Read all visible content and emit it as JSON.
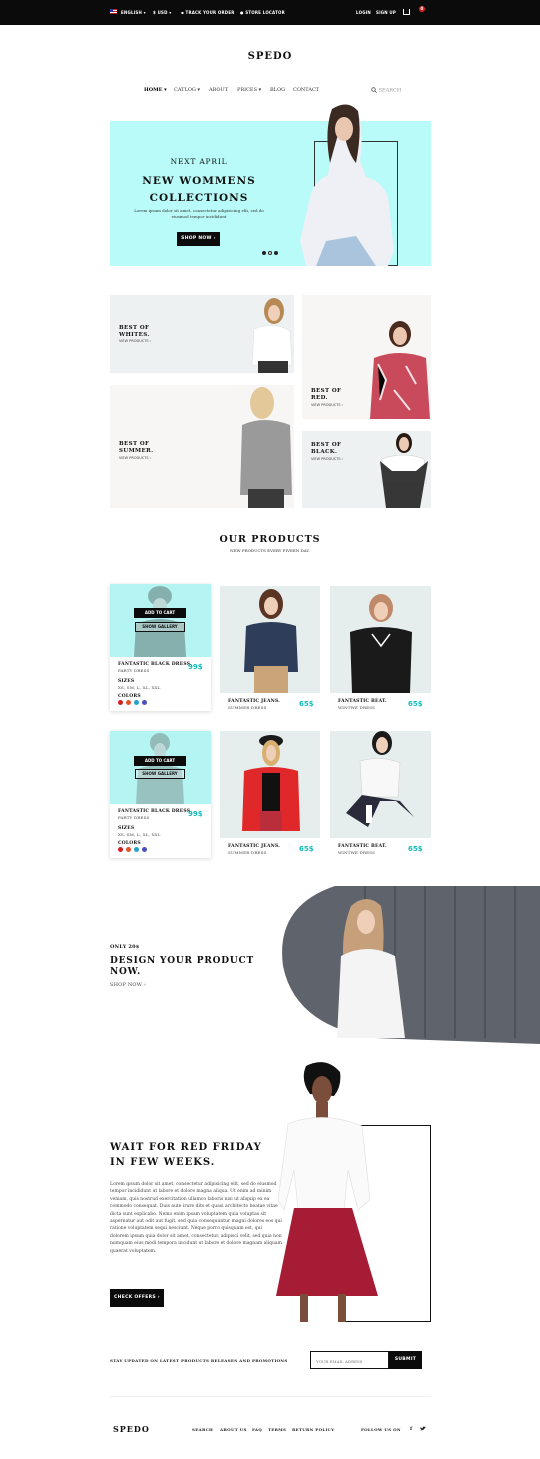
{
  "topbar": {
    "language": "ENGLISH",
    "currency": "USD",
    "track": "TRACK YOUR ORDER",
    "store": "STORE LOCATOR",
    "login": "LOGIN",
    "signup": "SIGN UP",
    "cart_count": "0"
  },
  "brand": "SPEDO",
  "nav": [
    {
      "label": "HOME"
    },
    {
      "label": "CATLOG"
    },
    {
      "label": "ABOUT"
    },
    {
      "label": "PRICES"
    },
    {
      "label": "BLOG"
    },
    {
      "label": "CONTACT"
    }
  ],
  "search_placeholder": "SEARCH",
  "hero": {
    "kicker": "NEXT APRIL",
    "title1": "NEW WOMMENS",
    "title2": "COLLECTIONS",
    "text": "Lorem ipsum dolor sit amet, consectetur adipisicing elit, sed do eiusmod tempor incididunt",
    "button": "SHOP NOW"
  },
  "tiles": [
    {
      "l1": "BEST OF",
      "l2": "WHITES.",
      "link": "VIEW PRODUCTS"
    },
    {
      "l1": "BEST OF",
      "l2": "RED.",
      "link": "VIEW PRODUCTS"
    },
    {
      "l1": "BEST OF",
      "l2": "SUMMER.",
      "link": "VIEW PRODUCTS"
    },
    {
      "l1": "BEST OF",
      "l2": "BLACK.",
      "link": "VIEW PRODUCTS"
    }
  ],
  "products_section": {
    "title": "OUR PRODUCTS",
    "subtitle": "NEW PRODUCTS EVERY FIVEEN DAY."
  },
  "card_actions": {
    "add": "ADD TO CART",
    "gallery": "SHOW GALLERY",
    "sizes_label": "SIZES",
    "sizes": "XS, SM, L, XL, XXL",
    "colors_label": "COLORS"
  },
  "products": [
    {
      "name": "FANTASTIC BLACK DRESS.",
      "sub": "PARTY DRESS",
      "price": "99$"
    },
    {
      "name": "FANTASTIC JEANS.",
      "sub": "SUMMER DRESS",
      "price": "65$"
    },
    {
      "name": "FANTASTIC BEAT.",
      "sub": "WINTWE DRESS",
      "price": "65$"
    },
    {
      "name": "FANTASTIC BLACK DRESS.",
      "sub": "PARTY DRESS",
      "price": "99$"
    },
    {
      "name": "FANTASTIC JEANS.",
      "sub": "SUMMER DRESS",
      "price": "65$"
    },
    {
      "name": "FANTASTIC BEAT.",
      "sub": "WINTWE DRESS",
      "price": "65$"
    }
  ],
  "swatch_colors": [
    "#d42020",
    "#e8502a",
    "#2a9fc4",
    "#4b4fc0"
  ],
  "design": {
    "kicker": "ONLY 20$",
    "title1": "DESIGN YOUR PRODUCT",
    "title2": "NOW.",
    "link": "SHOP NOW"
  },
  "friday": {
    "title1": "WAIT FOR RED FRIDAY",
    "title2": "IN FEW WEEKS.",
    "text": "Lorem ipsum dolor sit amet, consectetur adipisicing elit, sed do eiusmod tempor incididunt ut labore et dolore magna aliqua. Ut enim ad minim veniam, quis nostrud exercitation ullamco laboris nisi ut aliquip ex ea commodo consequat. Duis aute irure dits et quasi architecto beatae vitae dicta sunt explicabo. Nemo enim ipsam voluptatem quia voluptas sit aspernatur aut odit aut fugit, sed quia consequuntur magni dolores eos qui ratione voluptatem sequi nesciunt. Neque porro quisquam est, qui dolorem ipsum quia dolor sit amet, consectetur, adipisci velit, sed quia non numquam eius modi tempora incidunt ut labore et dolore magnam aliquam quaerat voluptatem.",
    "button": "CHECK OFFERS"
  },
  "newsletter": {
    "text": "STAY UPDATED ON LATEST PRODUCTS RELEASES AND PROMOTIONS",
    "placeholder": "YOUR EMAIL ADRESS",
    "button": "SUBMIT"
  },
  "footer": {
    "links": [
      "SEARCH",
      "ABOUT US",
      "FAQ",
      "TERMS",
      "RETURN POLICY"
    ],
    "follow": "FOLLOW US ON",
    "fb": "f"
  }
}
